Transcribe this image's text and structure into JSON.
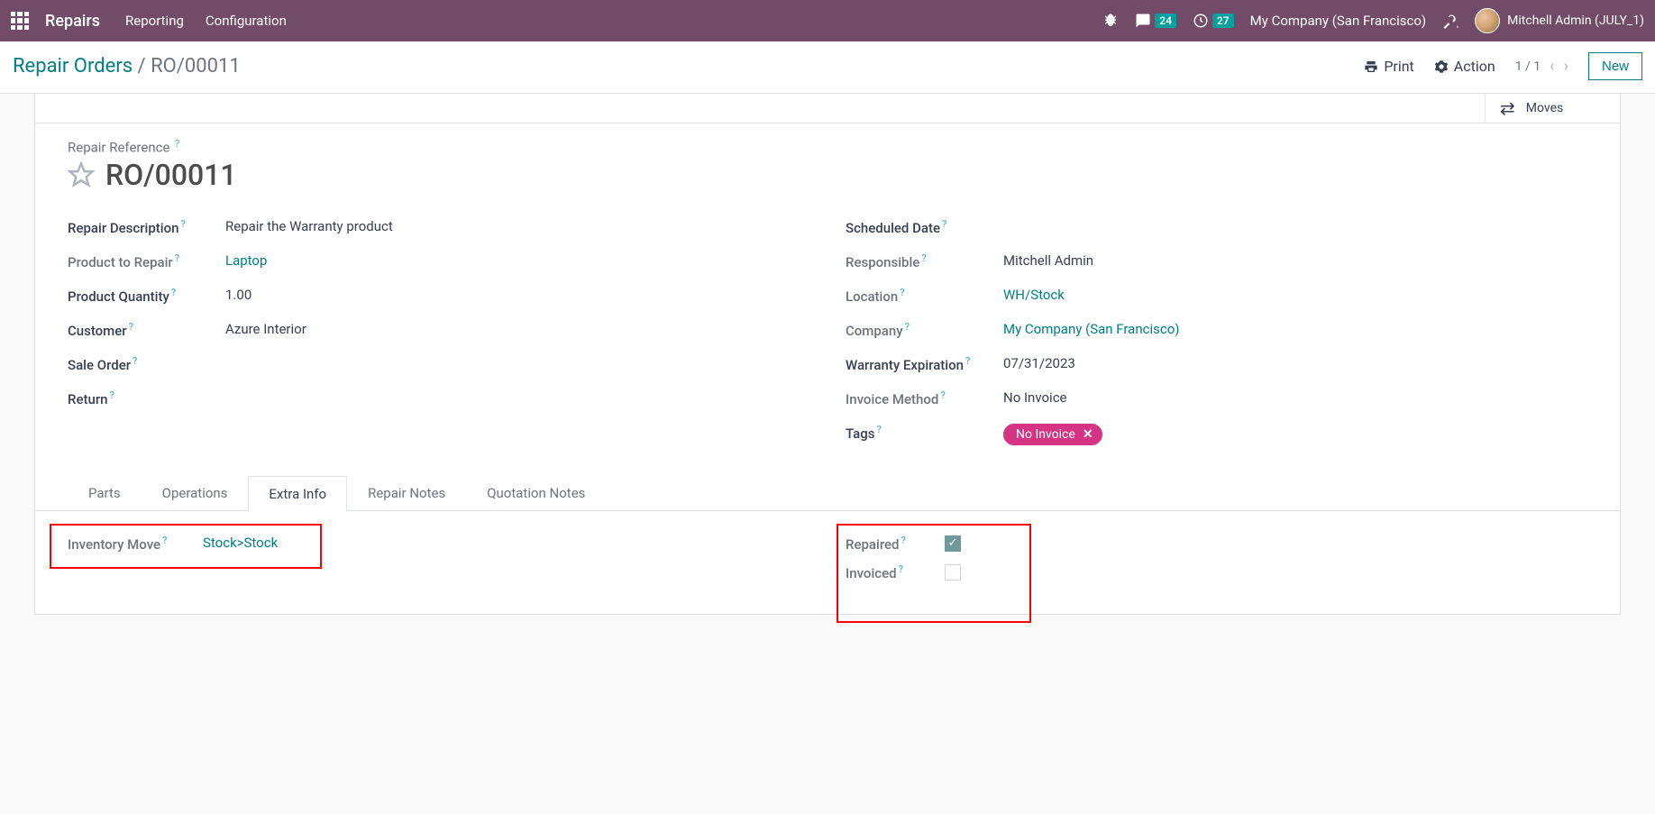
{
  "topnav": {
    "brand": "Repairs",
    "links": [
      "Reporting",
      "Configuration"
    ],
    "msg_count": "24",
    "clock_count": "27",
    "company": "My Company (San Francisco)",
    "user": "Mitchell Admin (JULY_1)"
  },
  "actionbar": {
    "breadcrumb_root": "Repair Orders",
    "breadcrumb_current": "RO/00011",
    "print": "Print",
    "action": "Action",
    "pager": "1 / 1",
    "new": "New"
  },
  "smart": {
    "moves": "Moves"
  },
  "form": {
    "ref_label": "Repair Reference",
    "ref_value": "RO/00011",
    "left": {
      "desc_label": "Repair Description",
      "desc_value": "Repair the Warranty  product",
      "product_label": "Product to Repair",
      "product_value": "Laptop",
      "qty_label": "Product Quantity",
      "qty_value": "1.00",
      "customer_label": "Customer",
      "customer_value": "Azure Interior",
      "sale_label": "Sale Order",
      "sale_value": "",
      "return_label": "Return",
      "return_value": ""
    },
    "right": {
      "sched_label": "Scheduled Date",
      "sched_value": "",
      "resp_label": "Responsible",
      "resp_value": "Mitchell Admin",
      "loc_label": "Location",
      "loc_value": "WH/Stock",
      "comp_label": "Company",
      "comp_value": "My Company (San Francisco)",
      "warr_label": "Warranty Expiration",
      "warr_value": "07/31/2023",
      "inv_label": "Invoice Method",
      "inv_value": "No Invoice",
      "tags_label": "Tags",
      "tag_pill": "No Invoice"
    }
  },
  "tabs": [
    "Parts",
    "Operations",
    "Extra Info",
    "Repair Notes",
    "Quotation Notes"
  ],
  "extra": {
    "inv_move_label": "Inventory Move",
    "inv_move_value": "Stock>Stock",
    "repaired_label": "Repaired",
    "invoiced_label": "Invoiced"
  }
}
